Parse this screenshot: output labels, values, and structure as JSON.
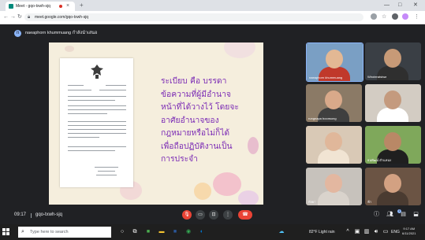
{
  "browser": {
    "tab_title": "Meet - gqo-txwh-sjq",
    "new_tab": "+",
    "tab_close": "×",
    "url": "meet.google.com/gqo-txwh-sjq",
    "window_controls": [
      "—",
      "□",
      "✕"
    ]
  },
  "meet": {
    "presenter_initial": "n",
    "presenter_text": "naeaphorn khummuang กำลังนำเสนอ",
    "time": "09:17",
    "meeting_code": "gqo-txwh-sjq",
    "chat_badge": "1"
  },
  "slide": {
    "lines": [
      "ระเบียบ  คือ  บรรดา",
      "ข้อความที่ผู้มีอำนาจ",
      "หน้าที่ได้วางไว้  โดยจะ",
      "อาศัยอำนาจของ",
      "กฎหมายหรือไม่ก็ได้",
      "เพื่อถือปฏิบัติงานเป็น",
      "การประจำ"
    ],
    "accent": "#7b2bb5"
  },
  "participants": [
    {
      "name": "naeaphorn khummuang",
      "bg": "#7a9fc4",
      "skin": "#e3b894",
      "shirt": "#c0392b"
    },
    {
      "name": "Wiroteratstwa",
      "bg": "#3a3f45",
      "skin": "#c79a77",
      "shirt": "#2f2f2f"
    },
    {
      "name": "rungnapa boonsong",
      "bg": "#8b7a66",
      "skin": "#d9a98a",
      "shirt": "#3f3f3f"
    },
    {
      "name": "",
      "bg": "#d3ccc3",
      "skin": "#c49a7e",
      "shirt": "#ffffff"
    },
    {
      "name": "",
      "bg": "#d9c9b6",
      "skin": "#e0b79a",
      "shirt": "#f1e4d3"
    },
    {
      "name": "ธนพัฒน์ ตำแหน่ง",
      "bg": "#7fa85b",
      "skin": "#b98866",
      "shirt": "#1f1f1f"
    },
    {
      "name": "กัลยา",
      "bg": "#c7c2bc",
      "skin": "#e3b7a0",
      "shirt": "#d9d3cc"
    },
    {
      "name": "ฟ้า",
      "bg": "#6b5444",
      "skin": "#d3a182",
      "shirt": "#4a3b31"
    }
  ],
  "taskbar": {
    "search_placeholder": "Type here to search",
    "weather": "82°F  Light rain",
    "lang": "ENG",
    "time": "9:17 AM",
    "date": "6/11/2021"
  },
  "colors": {
    "meet_bg": "#202124",
    "end_call": "#ea4335",
    "mic_off": "#ea4335",
    "accent_blue": "#8ab4f8"
  },
  "icons": [
    "mic-off-icon",
    "camera-icon",
    "present-icon",
    "more-icon",
    "end-call-icon",
    "info-icon",
    "people-icon",
    "chat-icon",
    "activities-icon"
  ]
}
